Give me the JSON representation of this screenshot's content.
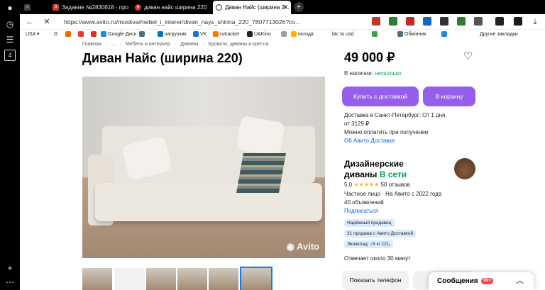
{
  "browser": {
    "tabs": [
      {
        "label": "",
        "icon": "avatar-icon"
      },
      {
        "label": "Задание №2830618 - про",
        "icon": "sp-favicon"
      },
      {
        "label": "диван найс ширина 220",
        "icon": "yandex-favicon"
      },
      {
        "label": "Диван Найс (ширина 2...",
        "icon": "loading-icon"
      }
    ],
    "url": "https://www.avito.ru/moskva/mebel_i_interer/divan_nays_shirina_220_7807713026?co...",
    "bookmarks": [
      "USA",
      "G",
      "",
      "",
      "Google Диск",
      "",
      "загрузчик",
      "VK",
      "rutracker",
      "UAKino",
      "",
      "погода",
      "btc to usd",
      "",
      "Обмінник",
      ""
    ],
    "other_bookmarks": "Другие закладки"
  },
  "breadcrumbs": [
    "Главная",
    "·",
    "...",
    "·",
    "Мебель и интерьер",
    "·",
    "Диваны",
    "·",
    "Кровати, диваны и кресла"
  ],
  "listing": {
    "title": "Диван Найс (ширина 220)",
    "watermark": "Avito",
    "price": "49 000 ₽",
    "availability_label": "В наличии:",
    "availability_value": "несколько",
    "buy_button": "Купить с доставкой",
    "cart_button": "В корзину",
    "delivery_line1": "Доставка в Санкт-Петербург: От 1 дня,",
    "delivery_line2": "от 3129 ₽",
    "delivery_line3": "Можно оплатить при получении",
    "delivery_link": "Об Авито Доставке"
  },
  "seller": {
    "name_line1": "Дизайнерские",
    "name_line2": "диваны",
    "online": "В сети",
    "rating": "5,0",
    "stars": "★★★★★",
    "reviews": "50 отзывов",
    "type": "Частное лицо · На Авито с 2022 года",
    "ads": "40 объявлений",
    "subscribe": "Подписаться",
    "badges": [
      "Надёжный продавец",
      "31 продажа с Авито Доставкой",
      "Эковклад: ~5 кг CO₂"
    ],
    "reply_time": "Отвечает около 30 минут"
  },
  "actions": {
    "phone_button": "Показать телефон",
    "messages": "Сообщения",
    "messages_badge": "99+"
  },
  "colors": {
    "accent": "#965eeb",
    "online": "#02a54e",
    "link": "#0a69d6"
  }
}
